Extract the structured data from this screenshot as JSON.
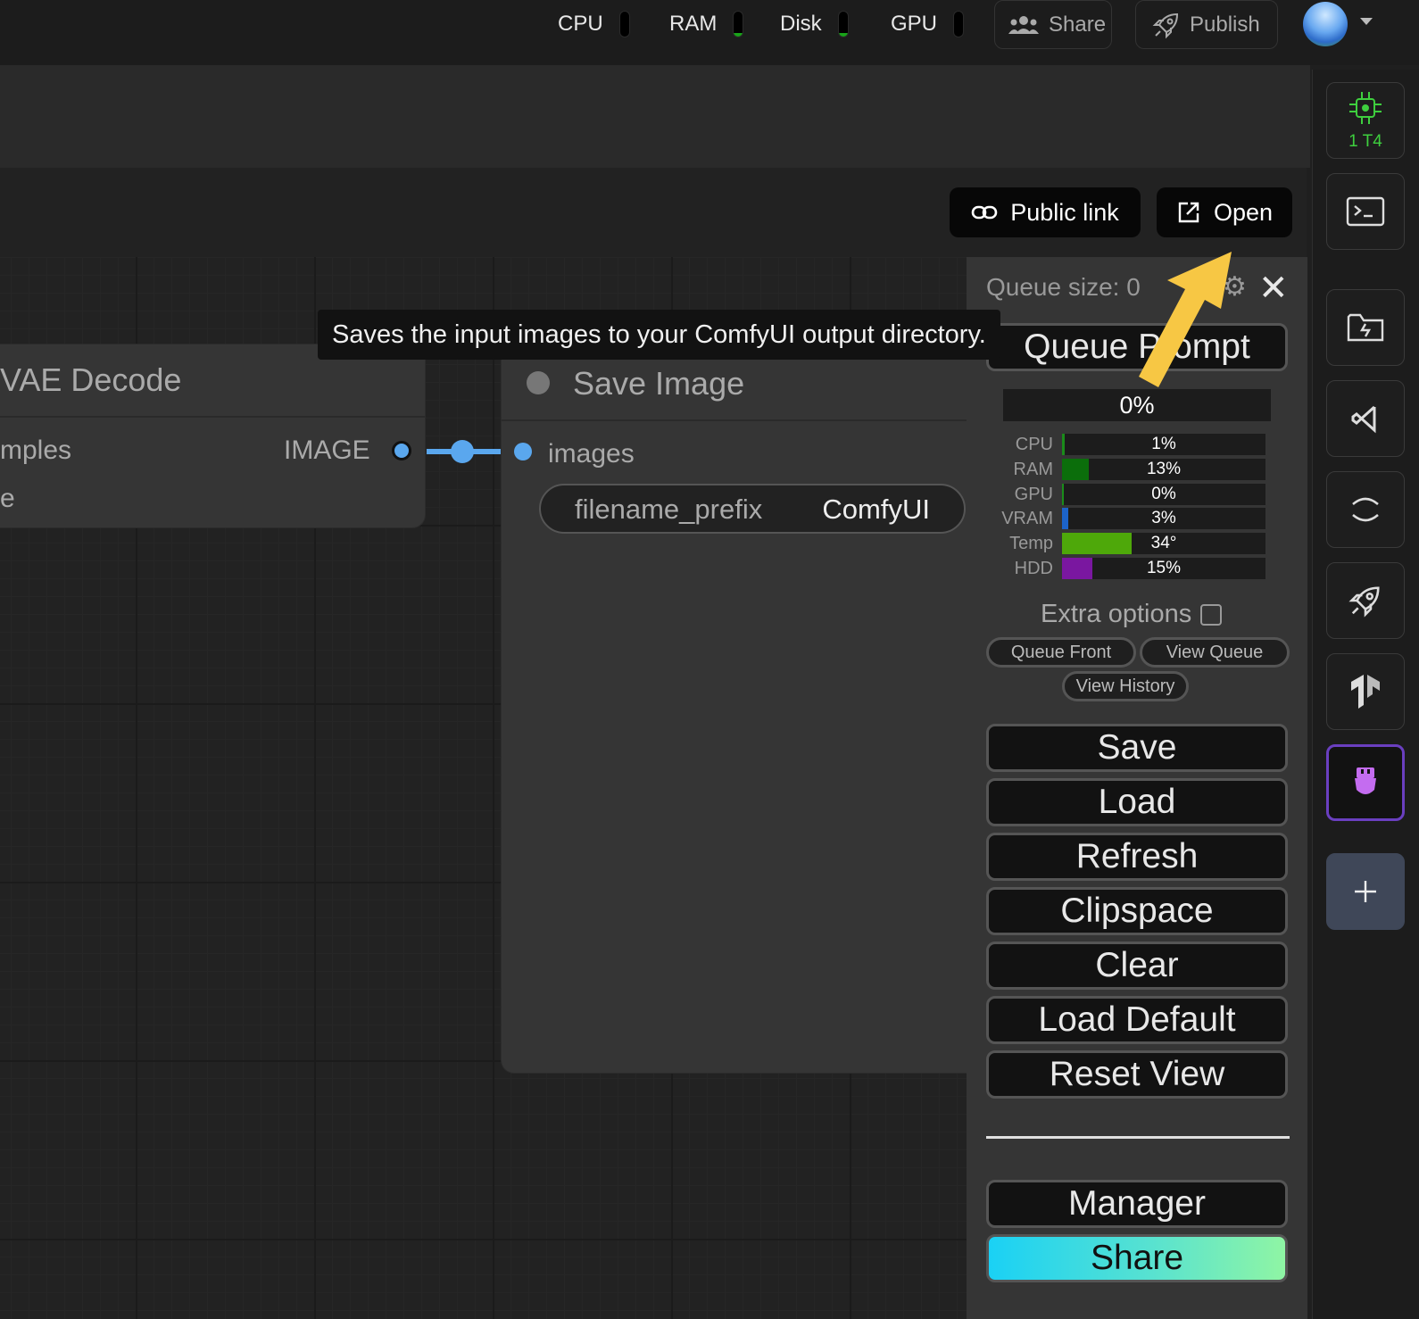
{
  "topbar": {
    "metrics": [
      {
        "label": "CPU",
        "level": 0.0
      },
      {
        "label": "RAM",
        "level": 0.15
      },
      {
        "label": "Disk",
        "level": 0.15
      },
      {
        "label": "GPU",
        "level": 0.0
      }
    ],
    "share_label": "Share",
    "publish_label": "Publish"
  },
  "rail": {
    "gpu_label": "1 T4"
  },
  "header": {
    "public_link_label": "Public link",
    "open_label": "Open"
  },
  "tooltip": "Saves the input images to your ComfyUI output directory.",
  "nodes": {
    "vae_decode": {
      "title": "VAE Decode",
      "input_partial": "mples",
      "output_label": "IMAGE",
      "second_partial": "e"
    },
    "save_image": {
      "title": "Save Image",
      "input_label": "images",
      "widget_name": "filename_prefix",
      "widget_value": "ComfyUI"
    }
  },
  "queue_panel": {
    "queue_size": "Queue size: 0",
    "queue_prompt": "Queue Prompt",
    "progress": "0%",
    "stats": [
      {
        "label": "CPU",
        "value": "1%",
        "level": 0.01,
        "color": "#1a8c1a"
      },
      {
        "label": "RAM",
        "value": "13%",
        "level": 0.13,
        "color": "#0b6e0b"
      },
      {
        "label": "GPU",
        "value": "0%",
        "level": 0.0,
        "color": "#1a8c1a"
      },
      {
        "label": "VRAM",
        "value": "3%",
        "level": 0.03,
        "color": "#1c63c9"
      },
      {
        "label": "Temp",
        "value": "34°",
        "level": 0.34,
        "color": "#4ea80a"
      },
      {
        "label": "HDD",
        "value": "15%",
        "level": 0.15,
        "color": "#7a17a0"
      }
    ],
    "extra_options": "Extra options",
    "queue_front": "Queue Front",
    "view_queue": "View Queue",
    "view_history": "View History",
    "buttons": [
      "Save",
      "Load",
      "Refresh",
      "Clipspace",
      "Clear",
      "Load Default",
      "Reset View"
    ],
    "manager": "Manager",
    "share": "Share"
  },
  "colors": {
    "accent_green": "#3ecf3e",
    "link_blue": "#5aa7ee",
    "arrow_yellow": "#f7c744",
    "active_purple": "#8a3fd6"
  }
}
